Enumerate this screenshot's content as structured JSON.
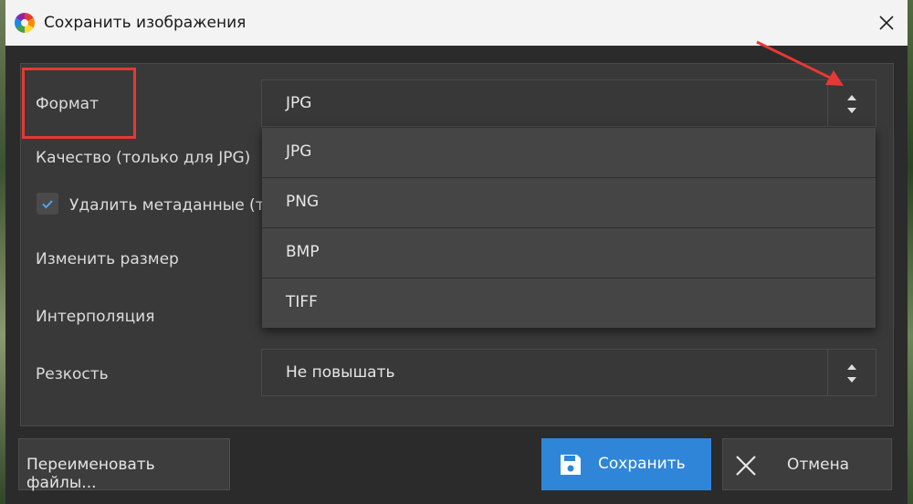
{
  "window": {
    "title": "Сохранить изображения"
  },
  "form": {
    "format_label": "Формат",
    "quality_label": "Качество (только для JPG)",
    "remove_metadata_label": "Удалить метаданные (то",
    "remove_metadata_checked": true,
    "resize_label": "Изменить размер",
    "interpolation_label": "Интерполяция",
    "sharpness_label": "Резкость",
    "format_value": "JPG",
    "sharpness_value": "Не повышать"
  },
  "format_dropdown": {
    "options": [
      "JPG",
      "PNG",
      "BMP",
      "TIFF"
    ]
  },
  "buttons": {
    "rename": "Переименовать файлы...",
    "save": "Сохранить",
    "cancel": "Отмена"
  },
  "colors": {
    "accent": "#2f86d9",
    "annotation": "#e53935"
  },
  "icons": {
    "app": "app-logo-icon",
    "close": "close-icon",
    "spin": "up-down-arrows-icon",
    "save": "floppy-disk-icon",
    "cancel": "x-icon",
    "check": "checkmark-icon"
  }
}
